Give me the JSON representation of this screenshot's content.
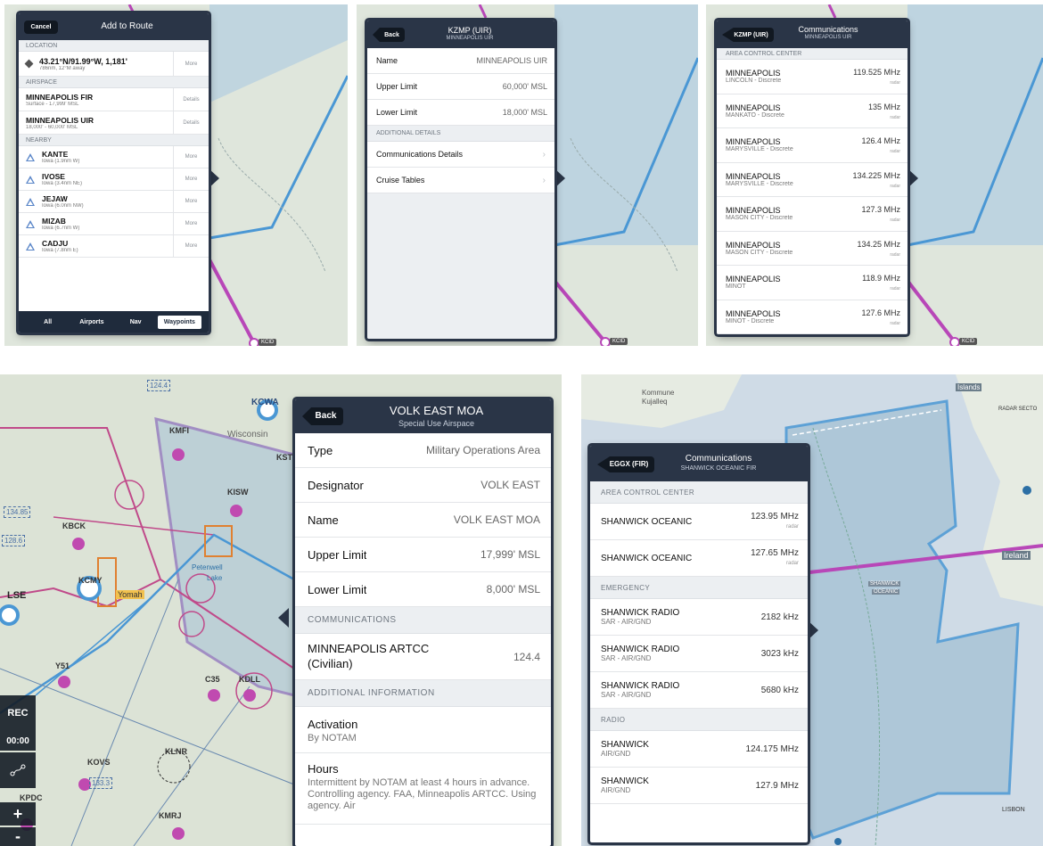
{
  "map": {
    "apt_kcid": "KCID",
    "wisconsin": "Wisconsin",
    "yomah": "Yomah",
    "petenwell": "Petenwell",
    "lake": "Lake",
    "kommune": "Kommune",
    "kujalleq": "Kujalleq",
    "islands": "Islands",
    "radar_sect": "RADAR SECTO",
    "shanwick_oceanic_l1": "SHANWICK",
    "shanwick_oceanic_l2": "OCEANIC",
    "ireland": "Ireland",
    "lisbon": "LISBON"
  },
  "p1": {
    "cancel": "Cancel",
    "title": "Add to Route",
    "sec_location": "LOCATION",
    "loc_name": "43.21°N/91.99°W, 1,181'",
    "loc_sub": "786nm, 12°M away",
    "more": "More",
    "sec_airspace": "AIRSPACE",
    "airspace": [
      {
        "name": "MINNEAPOLIS FIR",
        "sub": "Surface - 17,999' MSL",
        "action": "Details"
      },
      {
        "name": "MINNEAPOLIS UIR",
        "sub": "18,000' - 60,000' MSL",
        "action": "Details"
      }
    ],
    "sec_nearby": "NEARBY",
    "nearby": [
      {
        "name": "KANTE",
        "sub": "Iowa (1.9nm W)"
      },
      {
        "name": "IVOSE",
        "sub": "Iowa (3.4nm NE)"
      },
      {
        "name": "JEJAW",
        "sub": "Iowa (6.0nm NW)"
      },
      {
        "name": "MIZAB",
        "sub": "Iowa (6.7nm W)"
      },
      {
        "name": "CADJU",
        "sub": "Iowa (7.8nm E)"
      }
    ],
    "filters": [
      "All",
      "Airports",
      "Nav",
      "Waypoints"
    ]
  },
  "p2": {
    "back": "Back",
    "title": "KZMP (UIR)",
    "subtitle": "MINNEAPOLIS UIR",
    "rows": [
      {
        "label": "Name",
        "value": "MINNEAPOLIS UIR"
      },
      {
        "label": "Upper Limit",
        "value": "60,000' MSL"
      },
      {
        "label": "Lower Limit",
        "value": "18,000' MSL"
      }
    ],
    "sec_details": "ADDITIONAL DETAILS",
    "links": [
      "Communications Details",
      "Cruise Tables"
    ]
  },
  "p3": {
    "back": "KZMP (UIR)",
    "title": "Communications",
    "subtitle": "MINNEAPOLIS UIR",
    "sec": "AREA CONTROL CENTER",
    "rows": [
      {
        "name": "MINNEAPOLIS",
        "sub": "LINCOLN - Discrete",
        "freq": "119.525 MHz",
        "type": "radar"
      },
      {
        "name": "MINNEAPOLIS",
        "sub": "MANKATO - Discrete",
        "freq": "135 MHz",
        "type": "radar"
      },
      {
        "name": "MINNEAPOLIS",
        "sub": "MARYSVILLE - Discrete",
        "freq": "126.4 MHz",
        "type": "radar"
      },
      {
        "name": "MINNEAPOLIS",
        "sub": "MARYSVILLE - Discrete",
        "freq": "134.225 MHz",
        "type": "radar"
      },
      {
        "name": "MINNEAPOLIS",
        "sub": "MASON CITY - Discrete",
        "freq": "127.3 MHz",
        "type": "radar"
      },
      {
        "name": "MINNEAPOLIS",
        "sub": "MASON CITY - Discrete",
        "freq": "134.25 MHz",
        "type": "radar"
      },
      {
        "name": "MINNEAPOLIS",
        "sub": "MINOT",
        "freq": "118.9 MHz",
        "type": "radar"
      },
      {
        "name": "MINNEAPOLIS",
        "sub": "MINOT - Discrete",
        "freq": "127.6 MHz",
        "type": "radar"
      }
    ]
  },
  "p4": {
    "back": "Back",
    "title": "VOLK EAST MOA",
    "subtitle": "Special Use Airspace",
    "rows": [
      {
        "label": "Type",
        "value": "Military Operations Area"
      },
      {
        "label": "Designator",
        "value": "VOLK EAST"
      },
      {
        "label": "Name",
        "value": "VOLK EAST MOA"
      },
      {
        "label": "Upper Limit",
        "value": "17,999' MSL"
      },
      {
        "label": "Lower Limit",
        "value": "8,000' MSL"
      }
    ],
    "sec_comm": "COMMUNICATIONS",
    "comm_name": "MINNEAPOLIS ARTCC (Civilian)",
    "comm_freq": "124.4",
    "sec_info": "ADDITIONAL INFORMATION",
    "activation_label": "Activation",
    "activation_value": "By NOTAM",
    "hours_label": "Hours",
    "hours_value": "Intermittent by NOTAM at least 4 hours in advance. Controlling agency. FAA, Minneapolis ARTCC. Using agency. Air",
    "map_labels": {
      "kcwa": "KCWA",
      "kmfi": "KMFI",
      "kst": "KST",
      "kisw": "KISW",
      "kbck": "KBCK",
      "kcmy": "KCMY",
      "lse": "LSE",
      "y51": "Y51",
      "c35": "C35",
      "kdll": "KDLL",
      "klnr": "KLNR",
      "kovs": "KOVS",
      "kpdc": "KPDC",
      "kmrj": "KMRJ",
      "f124": "124.4",
      "f134": "134.85",
      "f128": "128.6",
      "f133": "133.3"
    },
    "ctrl": {
      "rec": "REC",
      "time": "00:00",
      "plus": "+",
      "minus": "-"
    }
  },
  "p5": {
    "back": "EGGX (FIR)",
    "title": "Communications",
    "subtitle": "SHANWICK OCEANIC FIR",
    "sections": [
      {
        "title": "AREA CONTROL CENTER",
        "rows": [
          {
            "name": "SHANWICK OCEANIC",
            "sub": "",
            "freq": "123.95 MHz",
            "type": "radar"
          },
          {
            "name": "SHANWICK OCEANIC",
            "sub": "",
            "freq": "127.65 MHz",
            "type": "radar"
          }
        ]
      },
      {
        "title": "EMERGENCY",
        "rows": [
          {
            "name": "SHANWICK RADIO",
            "sub": "SAR - AIR/GND",
            "freq": "2182 kHz",
            "type": ""
          },
          {
            "name": "SHANWICK RADIO",
            "sub": "SAR - AIR/GND",
            "freq": "3023 kHz",
            "type": ""
          },
          {
            "name": "SHANWICK RADIO",
            "sub": "SAR - AIR/GND",
            "freq": "5680 kHz",
            "type": ""
          }
        ]
      },
      {
        "title": "RADIO",
        "rows": [
          {
            "name": "SHANWICK",
            "sub": "AIR/GND",
            "freq": "124.175 MHz",
            "type": ""
          },
          {
            "name": "SHANWICK",
            "sub": "AIR/GND",
            "freq": "127.9 MHz",
            "type": ""
          }
        ]
      }
    ]
  }
}
